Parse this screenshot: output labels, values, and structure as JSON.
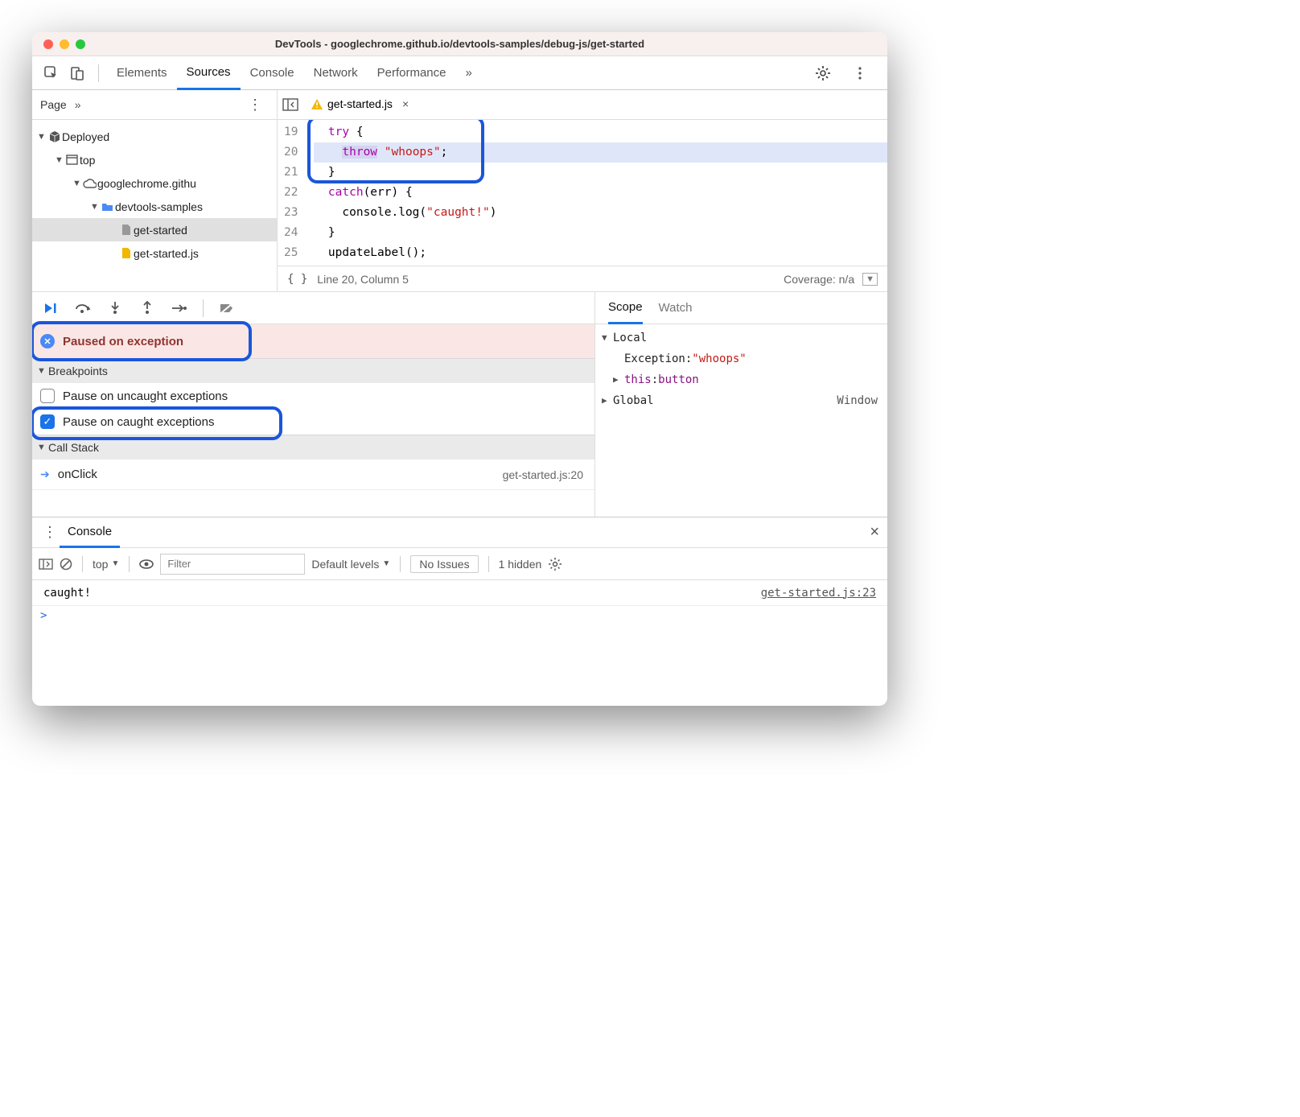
{
  "window_title": "DevTools - googlechrome.github.io/devtools-samples/debug-js/get-started",
  "toolbar": {
    "tabs": [
      "Elements",
      "Sources",
      "Console",
      "Network",
      "Performance"
    ],
    "active_tab": "Sources",
    "overflow": "»"
  },
  "sidebar": {
    "header": "Page",
    "overflow": "»",
    "tree": {
      "deployed": "Deployed",
      "top": "top",
      "domain": "googlechrome.githu",
      "folder": "devtools-samples",
      "file_html": "get-started",
      "file_js": "get-started.js"
    }
  },
  "editor_tab": {
    "filename": "get-started.js"
  },
  "code": {
    "lines": [
      19,
      20,
      21,
      22,
      23,
      24,
      25
    ],
    "l19": "  try {",
    "l20_kw": "throw",
    "l20_str": "\"whoops\"",
    "l21": "  }",
    "l22a": "  catch",
    "l22b": "(err) {",
    "l23a": "    console.log(",
    "l23b": "\"caught!\"",
    "l23c": ")",
    "l24": "  }",
    "l25": "  updateLabel();"
  },
  "editor_status": {
    "cursor": "Line 20, Column 5",
    "coverage": "Coverage: n/a"
  },
  "debugger": {
    "paused_msg": "Paused on exception",
    "sections": {
      "breakpoints": "Breakpoints",
      "callstack": "Call Stack"
    },
    "bp_uncaught": "Pause on uncaught exceptions",
    "bp_caught": "Pause on caught exceptions",
    "stack_frame": "onClick",
    "stack_loc": "get-started.js:20"
  },
  "scope": {
    "tabs": [
      "Scope",
      "Watch"
    ],
    "local": "Local",
    "exception_label": "Exception",
    "exception_val": "\"whoops\"",
    "this_label": "this",
    "this_val": "button",
    "global": "Global",
    "global_val": "Window"
  },
  "console": {
    "tab": "Console",
    "context": "top",
    "filter_placeholder": "Filter",
    "levels": "Default levels",
    "no_issues": "No Issues",
    "hidden": "1 hidden",
    "log_text": "caught!",
    "log_src": "get-started.js:23",
    "prompt": ">"
  }
}
